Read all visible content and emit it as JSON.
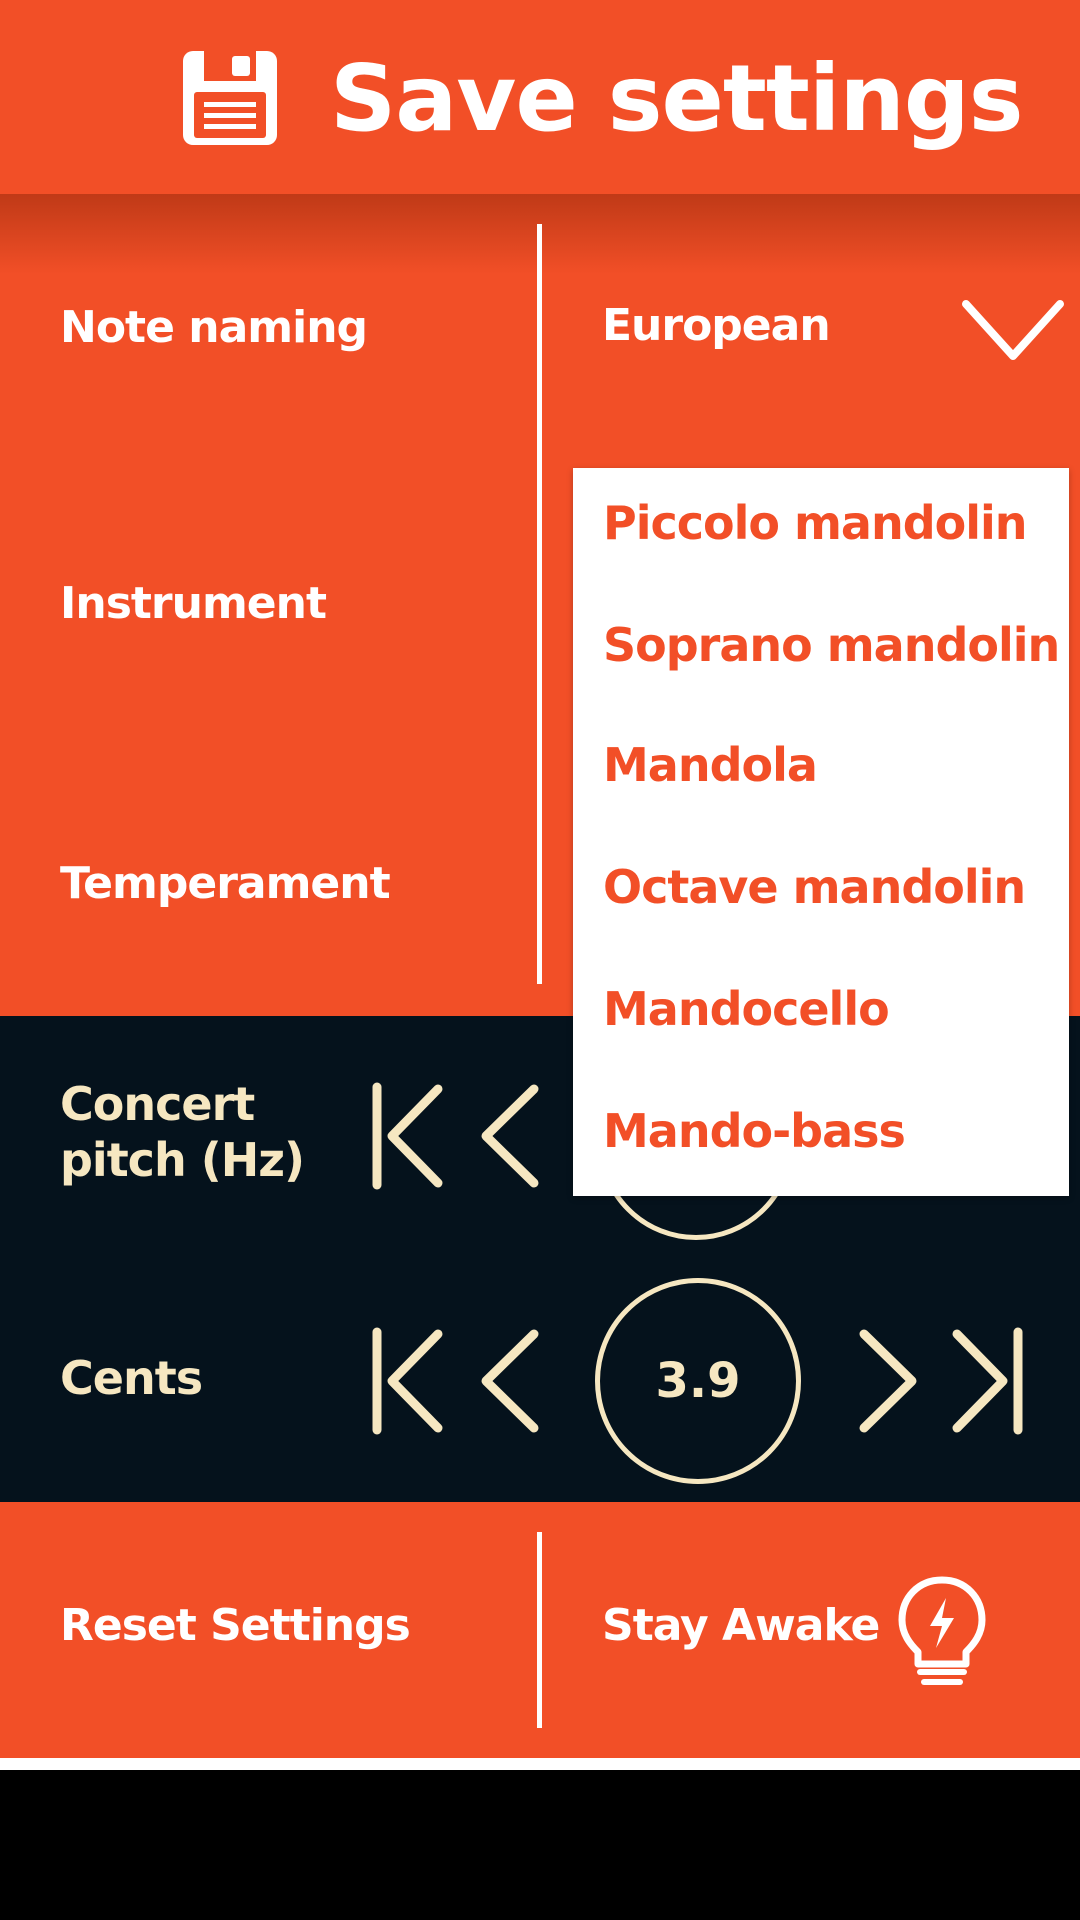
{
  "header": {
    "title": "Save settings",
    "icon": "floppy-disk-icon"
  },
  "settings": {
    "note_naming_label": "Note naming",
    "note_naming_value": "European",
    "instrument_label": "Instrument",
    "temperament_label": "Temperament"
  },
  "dropdown": {
    "options": [
      "Piccolo mandolin",
      "Soprano mandolin",
      "Mandola",
      "Octave mandolin",
      "Mandocello",
      "Mando-bass"
    ]
  },
  "controls": {
    "concert_pitch_label_line1": "Concert",
    "concert_pitch_label_line2": "pitch (Hz)",
    "cents_label": "Cents",
    "cents_value": "3.9"
  },
  "bottom": {
    "reset_label": "Reset Settings",
    "stay_awake_label": "Stay Awake",
    "stay_awake_icon": "lightbulb-bolt-icon"
  },
  "colors": {
    "accent": "#f24f27",
    "dark": "#05121c",
    "cream": "#f6e7c1"
  }
}
